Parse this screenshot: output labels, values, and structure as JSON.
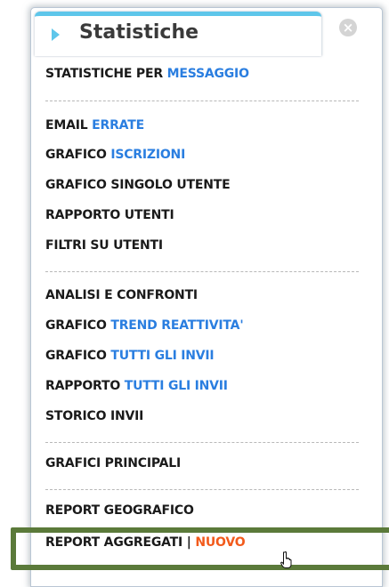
{
  "panel": {
    "title": "Statistiche",
    "close_glyph": "×",
    "arrow_icon": "triangle-right-icon",
    "accent_color": "#5ec6ea",
    "close_icon": "close-circle-icon"
  },
  "menu": {
    "item1": {
      "main": "STATISTICHE PER ",
      "accent": "MESSAGGIO"
    },
    "item2": {
      "main": "EMAIL ",
      "accent": "ERRATE"
    },
    "item3": {
      "main": "GRAFICO ",
      "accent": "ISCRIZIONI"
    },
    "item4": {
      "main": "GRAFICO SINGOLO UTENTE"
    },
    "item5": {
      "main": "RAPPORTO UTENTI"
    },
    "item6": {
      "main": "FILTRI SU UTENTI"
    },
    "item7": {
      "main": "ANALISI E CONFRONTI"
    },
    "item8": {
      "main": "GRAFICO ",
      "accent": "TREND REATTIVITA'"
    },
    "item9": {
      "main": "GRAFICO ",
      "accent": "TUTTI GLI INVII"
    },
    "item10": {
      "main": "RAPPORTO ",
      "accent": "TUTTI GLI INVII"
    },
    "item11": {
      "main": "STORICO INVII"
    },
    "item12": {
      "main": "GRAFICI PRINCIPALI"
    },
    "item13": {
      "main": "REPORT GEOGRAFICO"
    },
    "item14": {
      "main": "REPORT AGGREGATI | ",
      "badge": "NUOVO"
    }
  },
  "colors": {
    "link_blue": "#2a7ee0",
    "new_badge_orange": "#f25a1b",
    "highlight_green": "#5b7a3a"
  }
}
